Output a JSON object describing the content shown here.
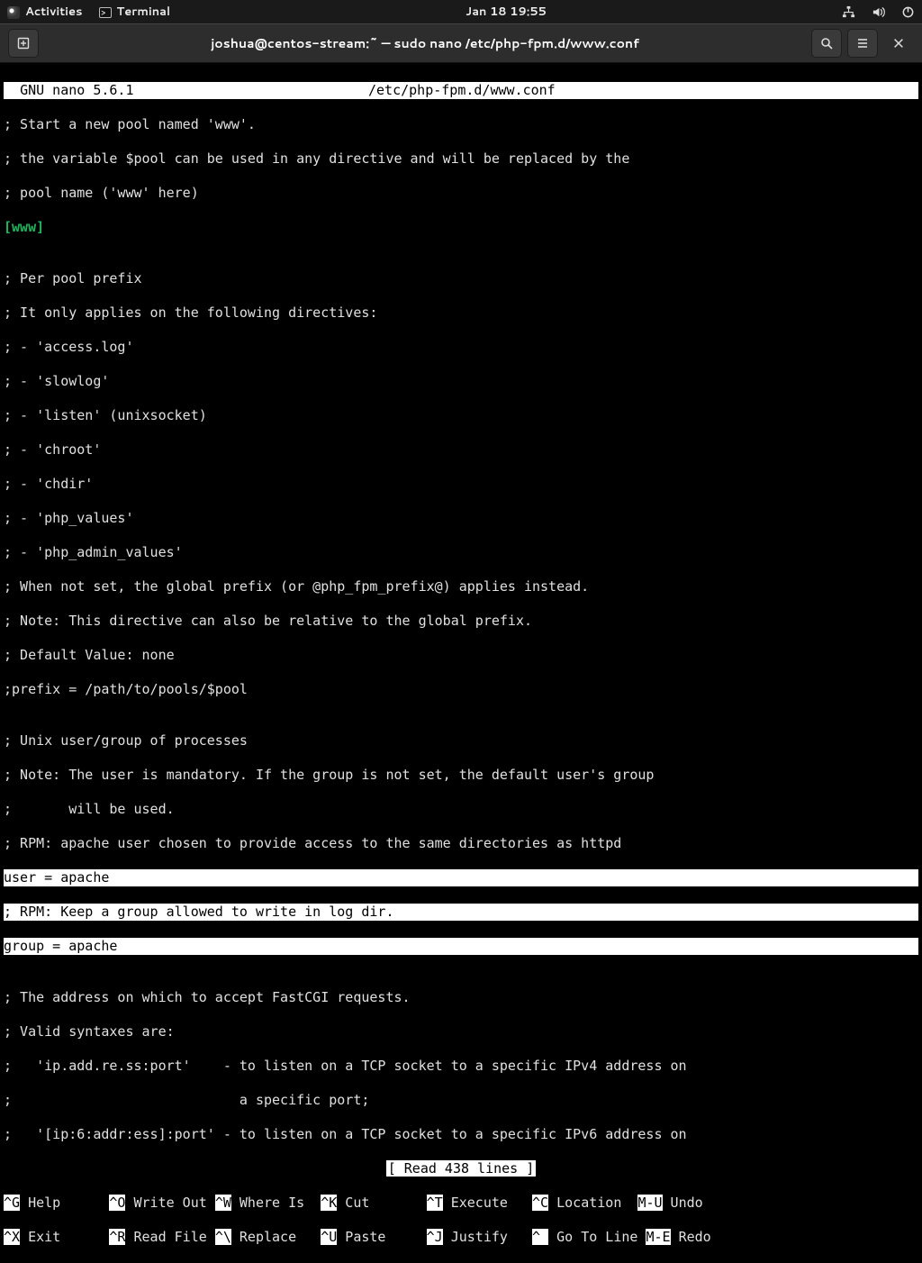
{
  "topbar": {
    "activities": "Activities",
    "terminal": "Terminal",
    "clock": "Jan 18  19:55"
  },
  "window": {
    "title": "joshua@centos-stream:~ — sudo nano /etc/php-fpm.d/www.conf"
  },
  "nano": {
    "version": "GNU nano 5.6.1",
    "filepath": "/etc/php-fpm.d/www.conf",
    "status": "[ Read 438 lines ]",
    "lines": {
      "l1": "; Start a new pool named 'www'.",
      "l2": "; the variable $pool can be used in any directive and will be replaced by the",
      "l3": "; pool name ('www' here)",
      "l4": "[www]",
      "l5": "",
      "l6": "; Per pool prefix",
      "l7": "; It only applies on the following directives:",
      "l8": "; - 'access.log'",
      "l9": "; - 'slowlog'",
      "l10": "; - 'listen' (unixsocket)",
      "l11": "; - 'chroot'",
      "l12": "; - 'chdir'",
      "l13": "; - 'php_values'",
      "l14": "; - 'php_admin_values'",
      "l15": "; When not set, the global prefix (or @php_fpm_prefix@) applies instead.",
      "l16": "; Note: This directive can also be relative to the global prefix.",
      "l17": "; Default Value: none",
      "l18": ";prefix = /path/to/pools/$pool",
      "l19": "",
      "l20": "; Unix user/group of processes",
      "l21": "; Note: The user is mandatory. If the group is not set, the default user's group",
      "l22": ";       will be used.",
      "l23": "; RPM: apache user chosen to provide access to the same directories as httpd",
      "l24": "user = apache",
      "l25": "; RPM: Keep a group allowed to write in log dir.",
      "l26": "group = apache",
      "l27": "",
      "l28": "; The address on which to accept FastCGI requests.",
      "l29": "; Valid syntaxes are:",
      "l30": ";   'ip.add.re.ss:port'    - to listen on a TCP socket to a specific IPv4 address on",
      "l31": ";                            a specific port;",
      "l32": ";   '[ip:6:addr:ess]:port' - to listen on a TCP socket to a specific IPv6 address on"
    },
    "shortcuts": {
      "kG": "^G",
      "help": " Help      ",
      "kO": "^O",
      "writeout": " Write Out ",
      "kW": "^W",
      "whereis": " Where Is  ",
      "kK": "^K",
      "cut": " Cut       ",
      "kT": "^T",
      "execute": " Execute   ",
      "kC": "^C",
      "location": " Location  ",
      "kMU": "M-U",
      "undo": " Undo",
      "kX": "^X",
      "exit": " Exit      ",
      "kR": "^R",
      "readfile": " Read File ",
      "kBS": "^\\",
      "replace": " Replace   ",
      "kU": "^U",
      "paste": " Paste     ",
      "kJ": "^J",
      "justify": " Justify   ",
      "kSL": "^ ",
      "gotoline": " Go To Line",
      "kME": "M-E",
      "redo": " Redo"
    }
  }
}
